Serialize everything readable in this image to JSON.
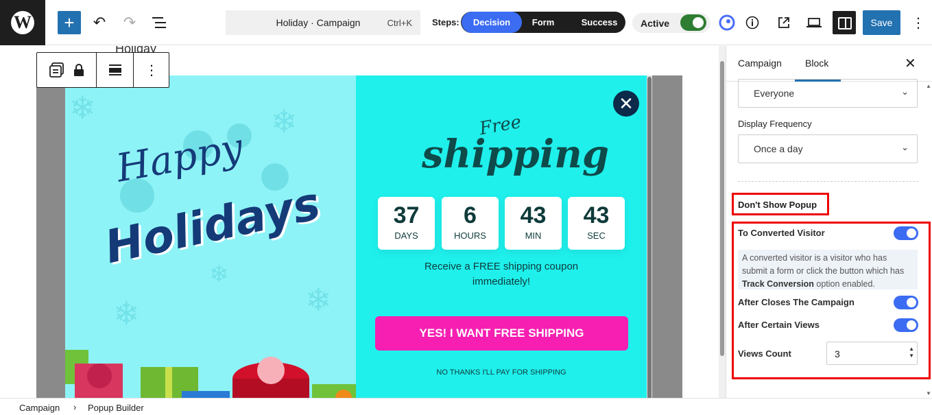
{
  "header": {
    "command_title": "Holiday · Campaign",
    "command_shortcut": "Ctrl+K",
    "steps_label": "Steps:",
    "steps": [
      "Decision",
      "Form",
      "Success"
    ],
    "active_label": "Active",
    "save_label": "Save"
  },
  "canvas": {
    "behind_heading": "Holiday",
    "popup": {
      "left_title_1": "Happy",
      "left_title_2": "Holidays",
      "free_label": "Free",
      "shipping_label": "shipping",
      "countdown": [
        {
          "value": "37",
          "unit": "DAYS"
        },
        {
          "value": "6",
          "unit": "HOURS"
        },
        {
          "value": "43",
          "unit": "MIN"
        },
        {
          "value": "43",
          "unit": "SEC"
        }
      ],
      "receive_text": "Receive a FREE shipping coupon immediately!",
      "cta_label": "YES! I WANT FREE SHIPPING",
      "no_thanks": "NO THANKS I'LL PAY FOR SHIPPING"
    }
  },
  "sidebar": {
    "tabs": [
      "Campaign",
      "Block"
    ],
    "audience_value": "Everyone",
    "display_frequency_label": "Display Frequency",
    "display_frequency_value": "Once a day",
    "dont_show_title": "Don't Show Popup",
    "to_converted_label": "To Converted Visitor",
    "help_text_1": "A converted visitor is a visitor who has submit a form or click the button which has",
    "help_bold": "Track Conversion",
    "help_text_2": " option enabled.",
    "after_closes_label": "After Closes The Campaign",
    "after_views_label": "After Certain Views",
    "views_count_label": "Views Count",
    "views_count_value": "3",
    "toggles": {
      "to_converted": true,
      "after_closes": true,
      "after_views": true
    }
  },
  "footer": {
    "crumb_1": "Campaign",
    "crumb_2": "Popup Builder"
  },
  "colors": {
    "accent": "#3b6cf2",
    "wp_blue": "#2271b1",
    "popup_left_bg": "#8ef3f6",
    "popup_right_bg": "#1ff0ec",
    "cta": "#f61fb2",
    "highlight": "#ee0000"
  }
}
